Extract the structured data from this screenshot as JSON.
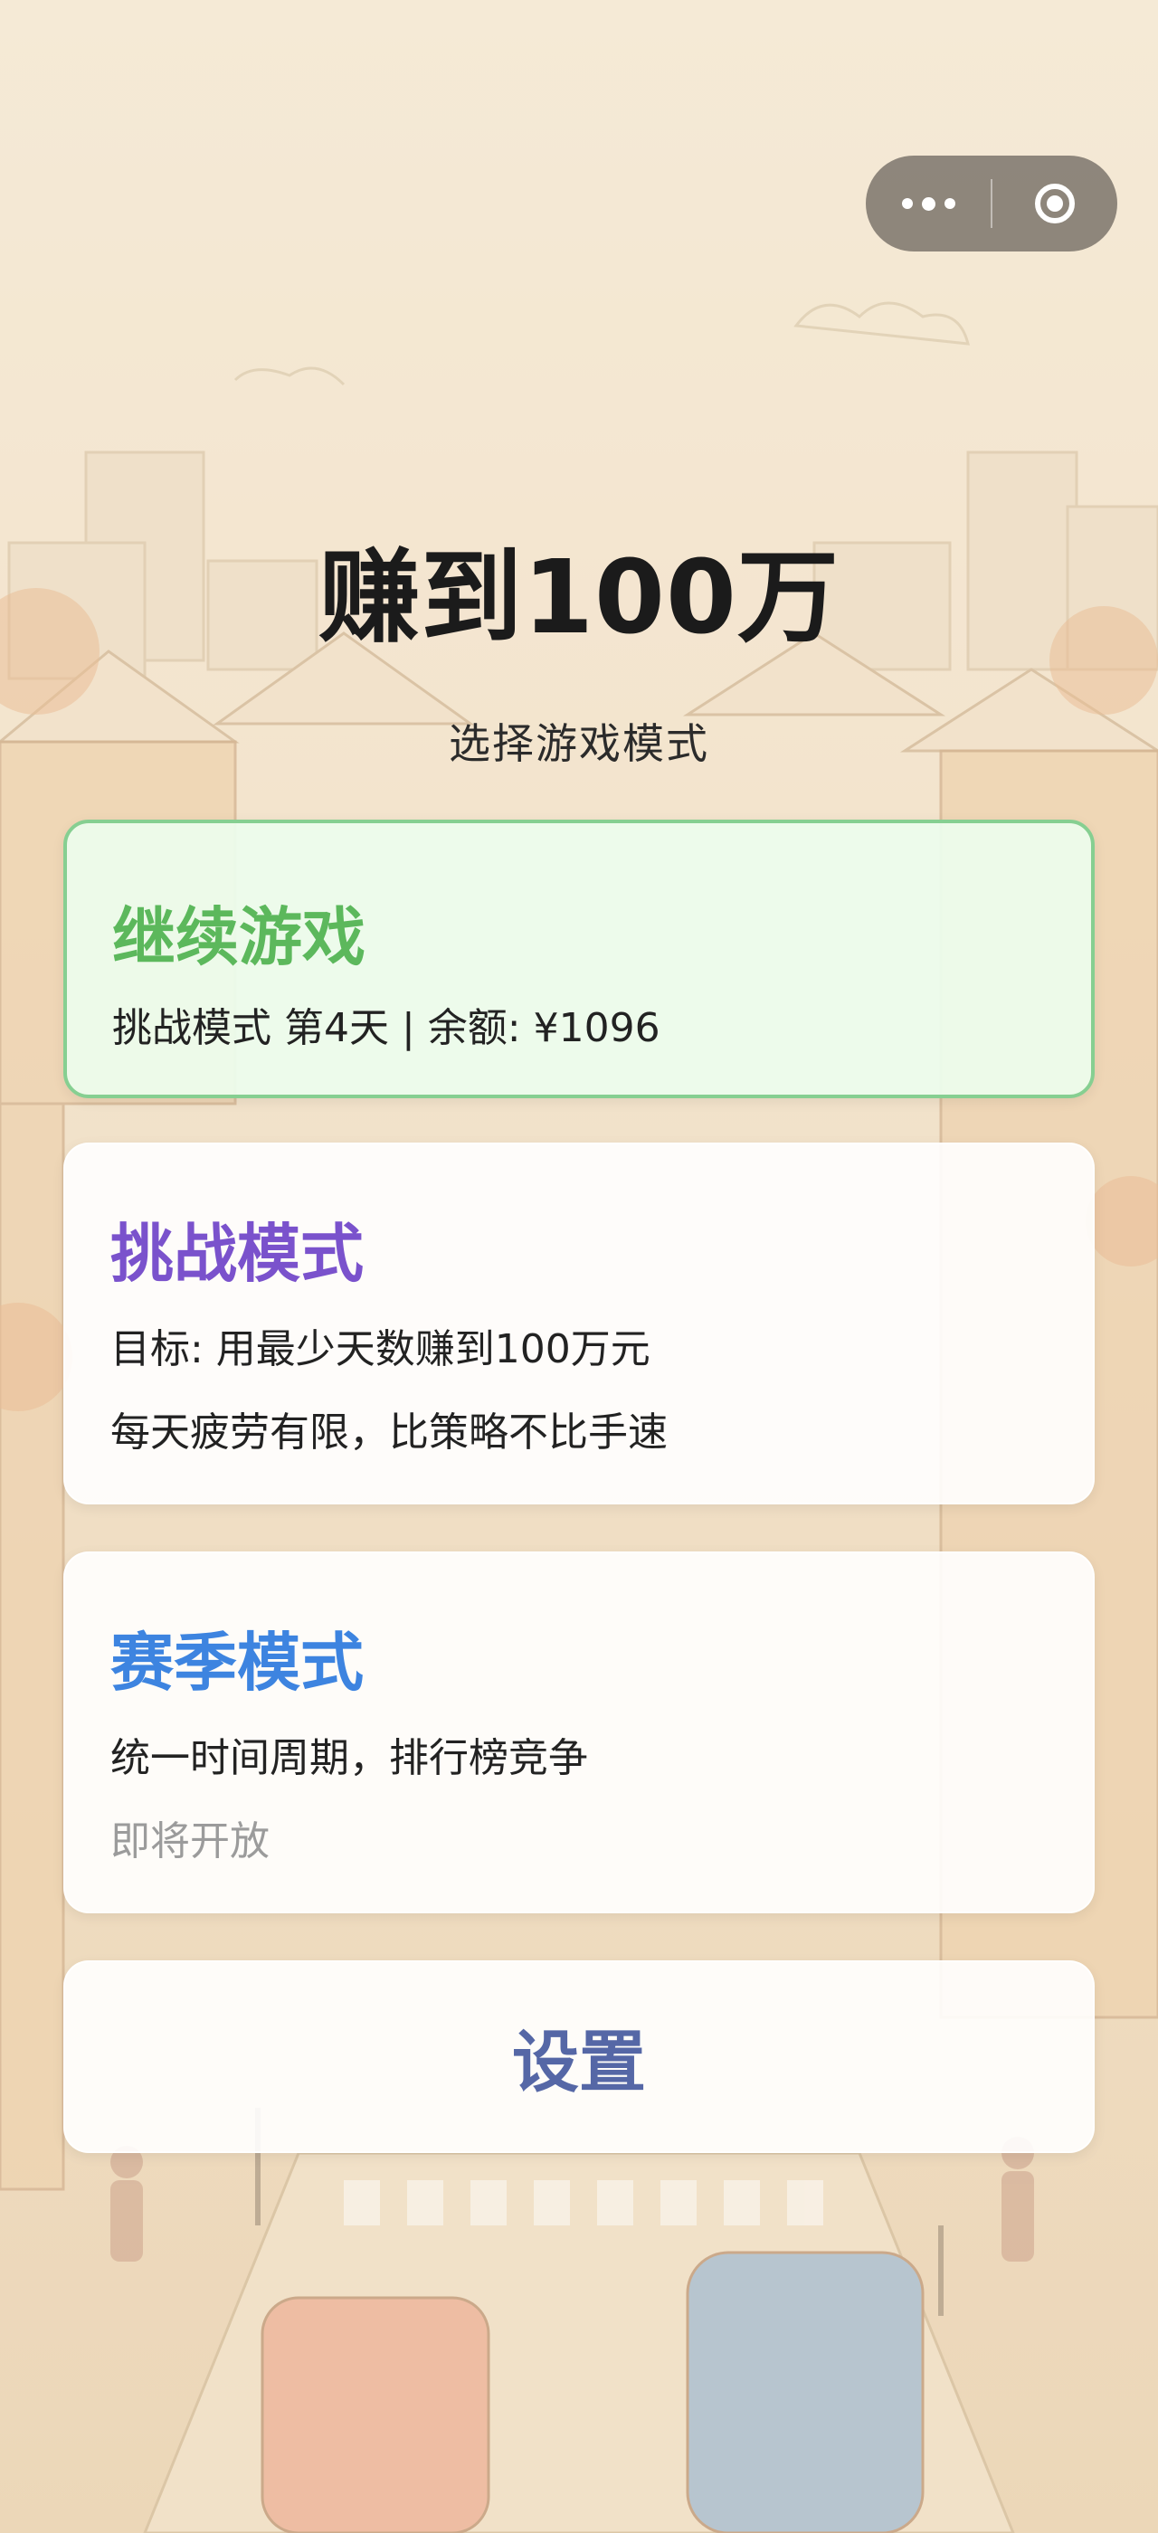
{
  "colors": {
    "continue_accent": "#5cb85c",
    "challenge_accent": "#7a52cc",
    "season_accent": "#3d84e0",
    "settings_accent": "#5567a6",
    "muted_text": "#9b9b9b"
  },
  "capsule": {
    "more_icon": "more-dots-icon",
    "close_icon": "close-ring-icon"
  },
  "header": {
    "title": "赚到100万",
    "subtitle": "选择游戏模式"
  },
  "cards": {
    "continue": {
      "title": "继续游戏",
      "detail": "挑战模式 第4天 | 余额: ¥1096"
    },
    "challenge": {
      "title": "挑战模式",
      "goal": "目标: 用最少天数赚到100万元",
      "note": "每天疲劳有限，比策略不比手速"
    },
    "season": {
      "title": "赛季模式",
      "desc": "统一时间周期，排行榜竞争",
      "status": "即将开放"
    },
    "settings": {
      "label": "设置"
    }
  }
}
